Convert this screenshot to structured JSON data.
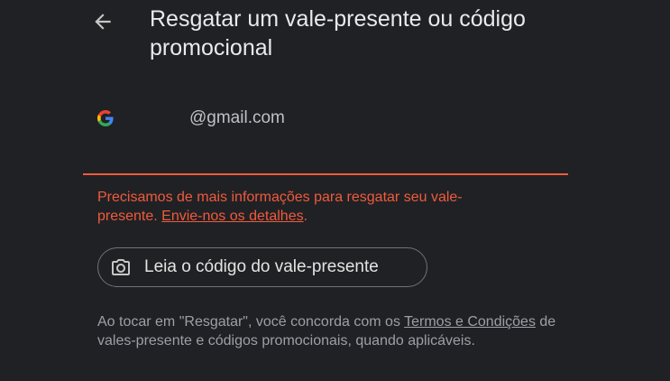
{
  "header": {
    "title": "Resgatar um vale-presente ou código promocional"
  },
  "account": {
    "email": "@gmail.com"
  },
  "error": {
    "text_before_link": "Precisamos de mais informações para resgatar seu vale-presente. ",
    "link_label": "Envie-nos os detalhes",
    "text_after_link": ".",
    "color": "#f05a3d"
  },
  "scan_button": {
    "label": "Leia o código do vale-presente",
    "icon": "camera-icon"
  },
  "terms": {
    "text_before_link": "Ao tocar em \"Resgatar\", você concorda com os ",
    "link_label": "Termos e Condições",
    "text_after_link": " de vales-presente e códigos promocionais, quando aplicáveis."
  },
  "colors": {
    "background": "#202124",
    "text_primary": "#e8eaed",
    "text_secondary": "#9aa0a6",
    "error": "#f05a3d"
  }
}
